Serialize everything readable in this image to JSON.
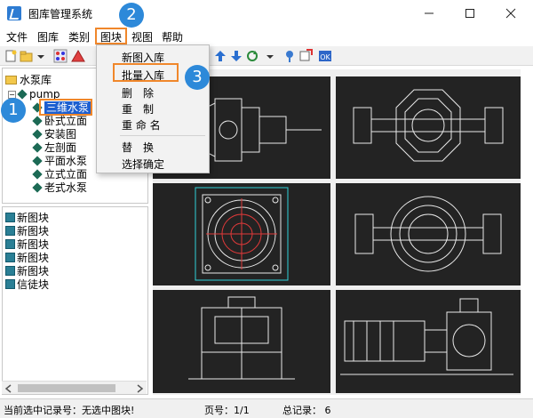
{
  "window": {
    "title": "图库管理系统",
    "minimize_icon": "minimize-icon",
    "maximize_icon": "maximize-icon",
    "close_icon": "close-icon"
  },
  "menu": [
    "文件",
    "图库",
    "类别",
    "图块",
    "视图",
    "帮助"
  ],
  "dropdown": {
    "items": [
      "新图入库",
      "批量入库",
      "删　除",
      "重　制",
      "重 命 名",
      "替　换",
      "选择确定"
    ],
    "highlighted": "批量入库"
  },
  "tree": {
    "root": "水泵库",
    "pump": "pump",
    "selected": "三维水泵",
    "children": [
      "卧式立面",
      "安装图",
      "左剖面",
      "平面水泵",
      "立式立面",
      "老式水泵"
    ]
  },
  "blocks": [
    "新图块",
    "新图块",
    "新图块",
    "新图块",
    "新图块",
    "信徒块"
  ],
  "status": {
    "selection": "当前选中记录号：无选中图块!",
    "page": "页号：1/1",
    "total": "总记录： 6"
  },
  "steps": [
    "1",
    "2",
    "3"
  ],
  "colors": {
    "accent": "#2d89d9",
    "highlight": "#f0872b",
    "selection": "#1d5fd0",
    "canvas": "#232323"
  }
}
